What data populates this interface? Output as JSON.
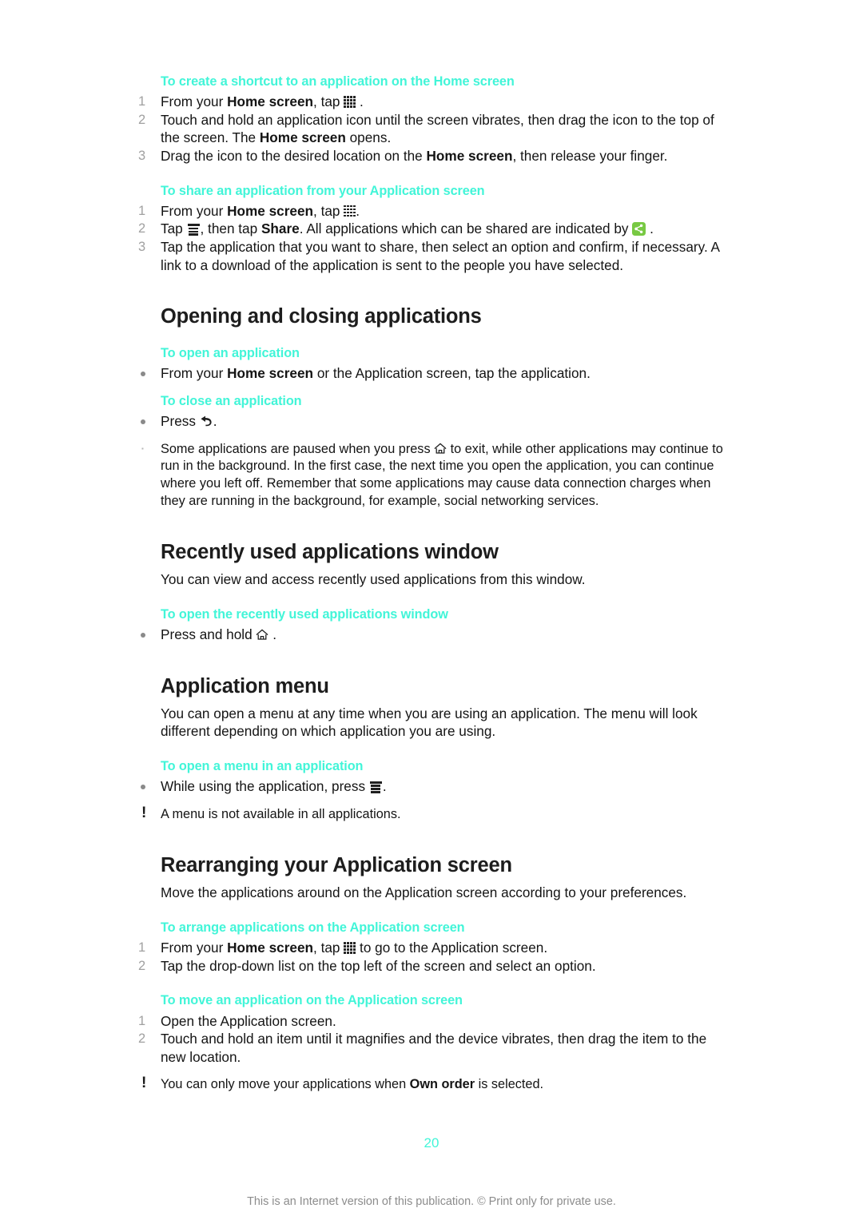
{
  "document": {
    "page_number": "20",
    "footer_note": "This is an Internet version of this publication. © Print only for private use."
  },
  "icons": {
    "app_grid": "app-grid-icon",
    "menu": "menu-icon",
    "share_badge": "share-badge-icon",
    "back": "back-arrow-icon",
    "home": "home-icon",
    "note": "exclamation-note-icon"
  },
  "colors": {
    "heading_accent": "#42f5d8",
    "share_badge_green": "#78c943",
    "marker_gray": "#a0a0a0",
    "footer_gray": "#8c8c8c"
  },
  "sections": {
    "shortcut": {
      "title": "To create a shortcut to an application on the Home screen",
      "steps": [
        {
          "num": "1",
          "pre": "From your ",
          "bold": "Home screen",
          "mid": ", tap ",
          "icon": "app-grid-icon",
          "post": " ."
        },
        {
          "num": "2",
          "pre": "Touch and hold an application icon until the screen vibrates, then drag the icon to the top of the screen. The ",
          "bold": "Home screen",
          "post": " opens."
        },
        {
          "num": "3",
          "pre": "Drag the icon to the desired location on the ",
          "bold": "Home screen",
          "post": ", then release your finger."
        }
      ]
    },
    "share_app": {
      "title": "To share an application from your Application screen",
      "steps": [
        {
          "num": "1",
          "pre": "From your ",
          "bold": "Home screen",
          "mid": ", tap ",
          "icon": "app-grid-icon",
          "post": "."
        },
        {
          "num": "2",
          "pre": "Tap ",
          "icon": "menu-icon",
          "mid": ", then tap ",
          "bold": "Share",
          "post": ". All applications which can be shared are indicated by ",
          "icon2": "share-badge-icon",
          "tail": " ."
        },
        {
          "num": "3",
          "pre": "Tap the application that you want to share, then select an option and confirm, if necessary. A link to a download of the application is sent to the people you have selected."
        }
      ]
    },
    "opening_closing": {
      "title": "Opening and closing applications",
      "open": {
        "title": "To open an application",
        "bullet": {
          "pre": "From your ",
          "bold": "Home screen",
          "post": " or the Application screen, tap the application."
        }
      },
      "close": {
        "title": "To close an application",
        "bullet": {
          "pre": "Press ",
          "icon": "back-arrow-icon",
          "post": "."
        }
      },
      "note": {
        "pre": "Some applications are paused when you press ",
        "icon": "home-icon",
        "post": " to exit, while other applications may continue to run in the background. In the first case, the next time you open the application, you can continue where you left off. Remember that some applications may cause data connection charges when they are running in the background, for example, social networking services."
      }
    },
    "recent_apps": {
      "title": "Recently used applications window",
      "intro": "You can view and access recently used applications from this window.",
      "task": {
        "title": "To open the recently used applications window",
        "bullet": {
          "pre": "Press and hold ",
          "icon": "home-icon",
          "post": " ."
        }
      }
    },
    "application_menu": {
      "title": "Application menu",
      "intro": "You can open a menu at any time when you are using an application. The menu will look different depending on which application you are using.",
      "task": {
        "title": "To open a menu in an application",
        "bullet": {
          "pre": "While using the application, press ",
          "icon": "menu-icon",
          "post": "."
        }
      },
      "note": "A menu is not available in all applications."
    },
    "rearranging": {
      "title": "Rearranging your Application screen",
      "intro": "Move the applications around on the Application screen according to your preferences.",
      "arrange": {
        "title": "To arrange applications on the Application screen",
        "steps": [
          {
            "num": "1",
            "pre": "From your ",
            "bold": "Home screen",
            "mid": ", tap ",
            "icon": "app-grid-icon",
            "post": " to go to the Application screen."
          },
          {
            "num": "2",
            "pre": "Tap the drop-down list on the top left of the screen and select an option."
          }
        ]
      },
      "move": {
        "title": "To move an application on the Application screen",
        "steps": [
          {
            "num": "1",
            "pre": "Open the Application screen."
          },
          {
            "num": "2",
            "pre": "Touch and hold an item until it magnifies and the device vibrates, then drag the item to the new location."
          }
        ],
        "note": {
          "pre": "You can only move your applications when ",
          "bold": "Own order",
          "post": " is selected."
        }
      }
    }
  }
}
